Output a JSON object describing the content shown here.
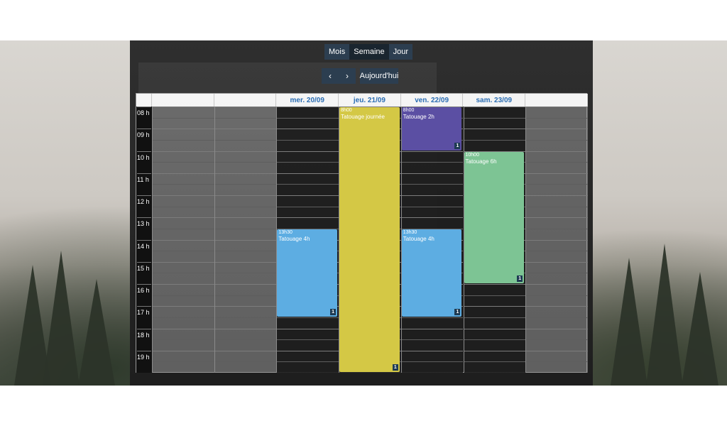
{
  "toolbar": {
    "views": [
      {
        "label": "Mois",
        "active": false
      },
      {
        "label": "Semaine",
        "active": true
      },
      {
        "label": "Jour",
        "active": false
      }
    ],
    "prev_icon": "chevron-left-icon",
    "next_icon": "chevron-right-icon",
    "today_label": "Aujourd'hui"
  },
  "calendar": {
    "days": [
      "",
      "",
      "mer. 20/09",
      "jeu. 21/09",
      "ven. 22/09",
      "sam. 23/09",
      ""
    ],
    "hours": [
      "08 h",
      "09 h",
      "10 h",
      "11 h",
      "12 h",
      "13 h",
      "14 h",
      "15 h",
      "16 h",
      "17 h",
      "18 h",
      "19 h"
    ],
    "events": [
      {
        "day": 2,
        "start": 13.5,
        "end": 17.5,
        "time": "13h30",
        "title": "Tatouage 4h",
        "color": "#5dade2",
        "badge": "1"
      },
      {
        "day": 3,
        "start": 8,
        "end": 20,
        "time": "8h00",
        "title": "Tatouage journée",
        "color": "#d4c845",
        "badge": "1"
      },
      {
        "day": 4,
        "start": 8,
        "end": 10,
        "time": "8h00",
        "title": "Tatouage 2h",
        "color": "#5b4fa3",
        "badge": "1"
      },
      {
        "day": 4,
        "start": 13.5,
        "end": 17.5,
        "time": "13h30",
        "title": "Tatouage 4h",
        "color": "#5dade2",
        "badge": "1"
      },
      {
        "day": 5,
        "start": 10,
        "end": 16,
        "time": "10h00",
        "title": "Tatouage 6h",
        "color": "#7dc494",
        "badge": "1"
      }
    ]
  }
}
